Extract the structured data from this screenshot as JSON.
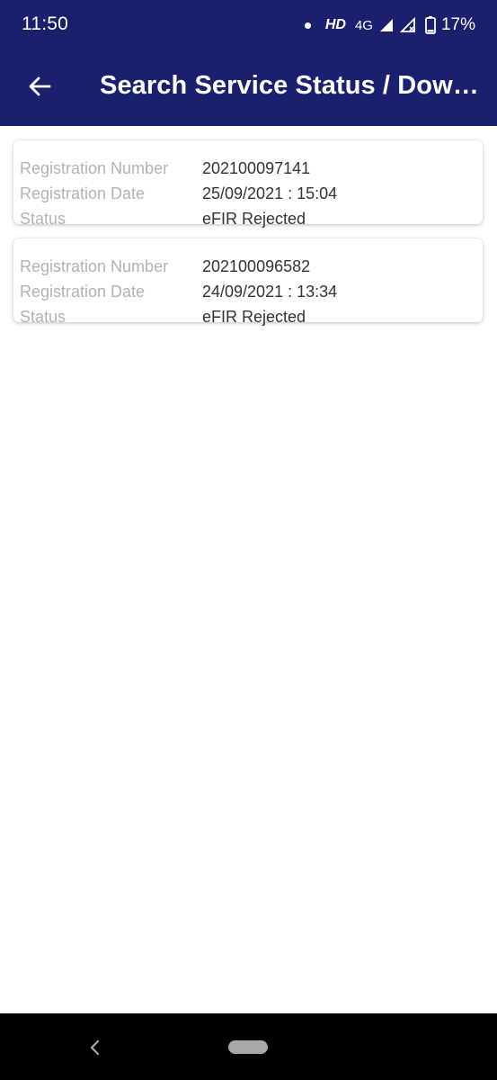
{
  "status_bar": {
    "time": "11:50",
    "hd_label": "HD",
    "network_label": "4G",
    "battery_percent": "17%"
  },
  "toolbar": {
    "title": "Search Service Status / Down..."
  },
  "labels": {
    "registration_number": "Registration Number",
    "registration_date": "Registration Date",
    "status": "Status"
  },
  "records": [
    {
      "registration_number": "202100097141",
      "registration_date": "25/09/2021 : 15:04",
      "status": "eFIR Rejected"
    },
    {
      "registration_number": "202100096582",
      "registration_date": "24/09/2021 : 13:34",
      "status": "eFIR Rejected"
    }
  ],
  "colors": {
    "app_bar": "#1a1f6e",
    "label_text": "#b3b3b3",
    "value_text": "#333333"
  }
}
